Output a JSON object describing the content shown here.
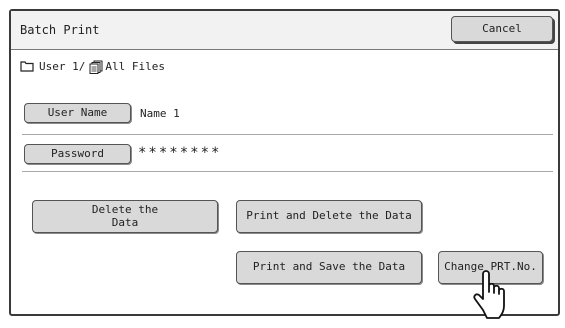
{
  "window": {
    "title": "Batch Print"
  },
  "header": {
    "cancel_label": "Cancel"
  },
  "breadcrumb": {
    "user": "User 1/",
    "folder": "All Files"
  },
  "fields": {
    "user_name_label": "User Name",
    "user_name_value": "Name 1",
    "password_label": "Password",
    "password_value": "********"
  },
  "actions": {
    "delete_label": "Delete the\nData",
    "print_delete_label": "Print and Delete the Data",
    "print_save_label": "Print and Save the Data",
    "change_prt_label": "Change PRT.No."
  },
  "icons": {
    "folder": "folder-icon",
    "files": "files-icon",
    "pointer": "hand-pointer-icon"
  }
}
